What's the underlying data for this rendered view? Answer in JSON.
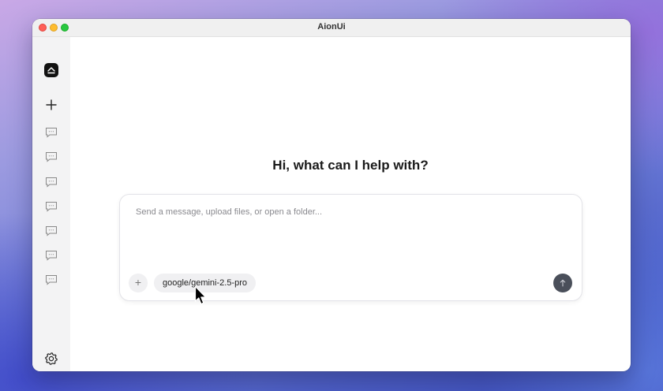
{
  "window": {
    "title": "AionUi"
  },
  "sidebar": {
    "logo_icon": "app-logo-icon",
    "new_chat_icon": "plus-icon",
    "chat_icon": "chat-bubble-icon",
    "chat_count": 7,
    "settings_icon": "gear-icon"
  },
  "main": {
    "greeting": "Hi, what can I help with?",
    "composer": {
      "placeholder": "Send a message, upload files, or open a folder...",
      "value": "",
      "attach_icon": "plus-icon",
      "attach_label": "+",
      "model": "google/gemini-2.5-pro",
      "send_icon": "arrow-up-icon"
    }
  },
  "colors": {
    "accent": "#4a4f5a",
    "sidebar_bg": "#f3f3f4",
    "close": "#ff5f57",
    "minimize": "#febc2e",
    "maximize": "#28c840"
  }
}
